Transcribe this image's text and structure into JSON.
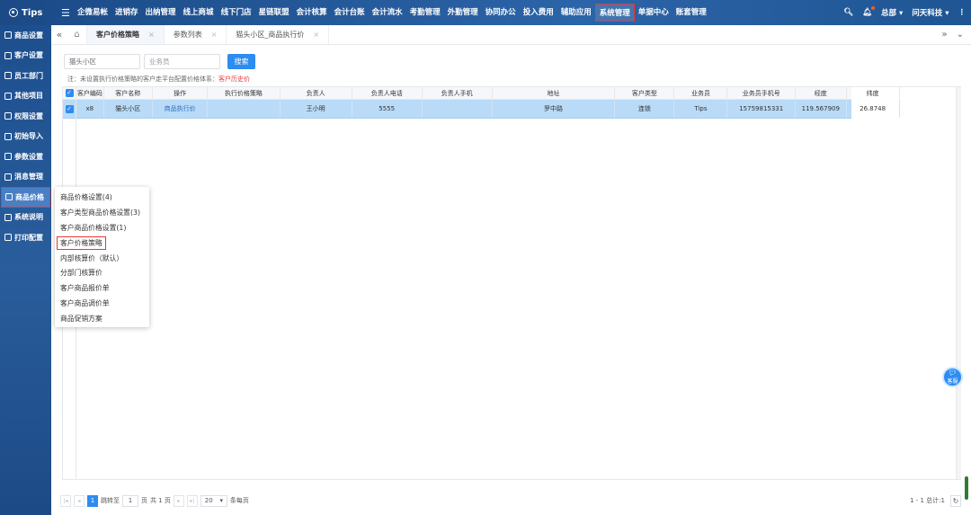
{
  "topbar": {
    "brand": "Tips",
    "menu": [
      "企微易帐",
      "进销存",
      "出纳管理",
      "线上商城",
      "线下门店",
      "星链联盟",
      "会计核算",
      "会计台账",
      "会计流水",
      "考勤管理",
      "外勤管理",
      "协同办公",
      "投入费用",
      "辅助应用",
      "系统管理",
      "单据中心",
      "账套管理"
    ],
    "active_menu_index": 14,
    "user": "总部",
    "company": "问天科技"
  },
  "sidebar": {
    "items": [
      {
        "label": "商品设置"
      },
      {
        "label": "客户设置"
      },
      {
        "label": "员工部门"
      },
      {
        "label": "其他项目"
      },
      {
        "label": "权限设置"
      },
      {
        "label": "初始导入"
      },
      {
        "label": "参数设置"
      },
      {
        "label": "消息管理"
      },
      {
        "label": "商品价格"
      },
      {
        "label": "系统说明"
      },
      {
        "label": "打印配置"
      }
    ],
    "active_index": 8
  },
  "tabs": [
    {
      "label": "客户价格策略",
      "active": true
    },
    {
      "label": "参数列表",
      "active": false
    },
    {
      "label": "猫头小区_商品执行价",
      "active": false
    }
  ],
  "search": {
    "customer_value": "猫头小区",
    "salesman_placeholder": "业务员",
    "button": "搜索"
  },
  "note": {
    "text": "注：未设置执行价格策略的客户走平台配置价格体系：",
    "link": "客户历史价"
  },
  "table": {
    "columns": [
      "客户编码",
      "客户名称",
      "操作",
      "执行价格策略",
      "负责人",
      "负责人电话",
      "负责人手机",
      "地址",
      "客户类型",
      "业务员",
      "业务员手机号",
      "经度",
      "纬度"
    ],
    "rows": [
      [
        "x8",
        "猫头小区",
        "商品执行价",
        "",
        "王小明",
        "5555",
        "",
        "罗中路",
        "连锁",
        "Tips",
        "15759815331",
        "119.567909",
        "26.8748"
      ]
    ]
  },
  "dropdown": {
    "items": [
      "商品价格设置(4)",
      "客户类型商品价格设置(3)",
      "客户商品价格设置(1)",
      "客户价格策略",
      "内部核算价（默认）",
      "分部门核算价",
      "客户商品报价单",
      "客户商品调价单",
      "商品促销方案"
    ],
    "active_index": 3
  },
  "pager": {
    "current_page": "1",
    "goto_label": "跳转至",
    "goto_value": "1",
    "page_unit": "页",
    "total_pages": "共 1 页",
    "page_size": "20",
    "per_page_label": "条每页",
    "summary": "1 - 1 总计:1"
  },
  "service": {
    "label": "客服"
  }
}
